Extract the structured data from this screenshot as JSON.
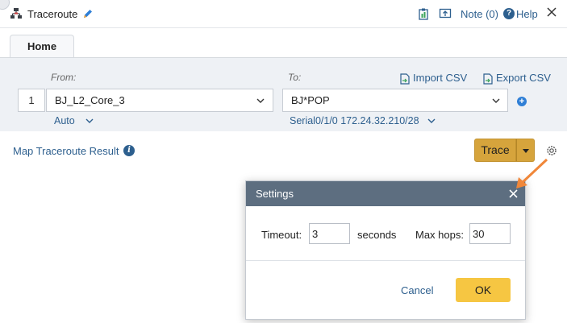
{
  "window": {
    "title": "Traceroute",
    "note_label": "Note (0)",
    "help_label": "Help"
  },
  "tabs": [
    {
      "label": "Home"
    }
  ],
  "form": {
    "from_label": "From:",
    "to_label": "To:",
    "import_label": "Import CSV",
    "export_label": "Export CSV",
    "row_number": "1",
    "from_value": "BJ_L2_Core_3",
    "to_value": "BJ*POP",
    "from_interface": "Auto",
    "to_interface": "Serial0/1/0 172.24.32.210/28"
  },
  "map_result": {
    "label": "Map Traceroute Result"
  },
  "trace_button": {
    "label": "Trace"
  },
  "settings_dialog": {
    "title": "Settings",
    "timeout_label": "Timeout:",
    "timeout_value": "3",
    "timeout_unit": "seconds",
    "maxhops_label": "Max hops:",
    "maxhops_value": "30",
    "cancel_label": "Cancel",
    "ok_label": "OK"
  },
  "colors": {
    "accent_blue": "#2d5f8e",
    "trace_gold": "#d6a43c",
    "ok_yellow": "#f6c642",
    "dialog_header": "#5d6e80",
    "panel_bg": "#eef1f5",
    "arrow_orange": "#f0873a"
  }
}
